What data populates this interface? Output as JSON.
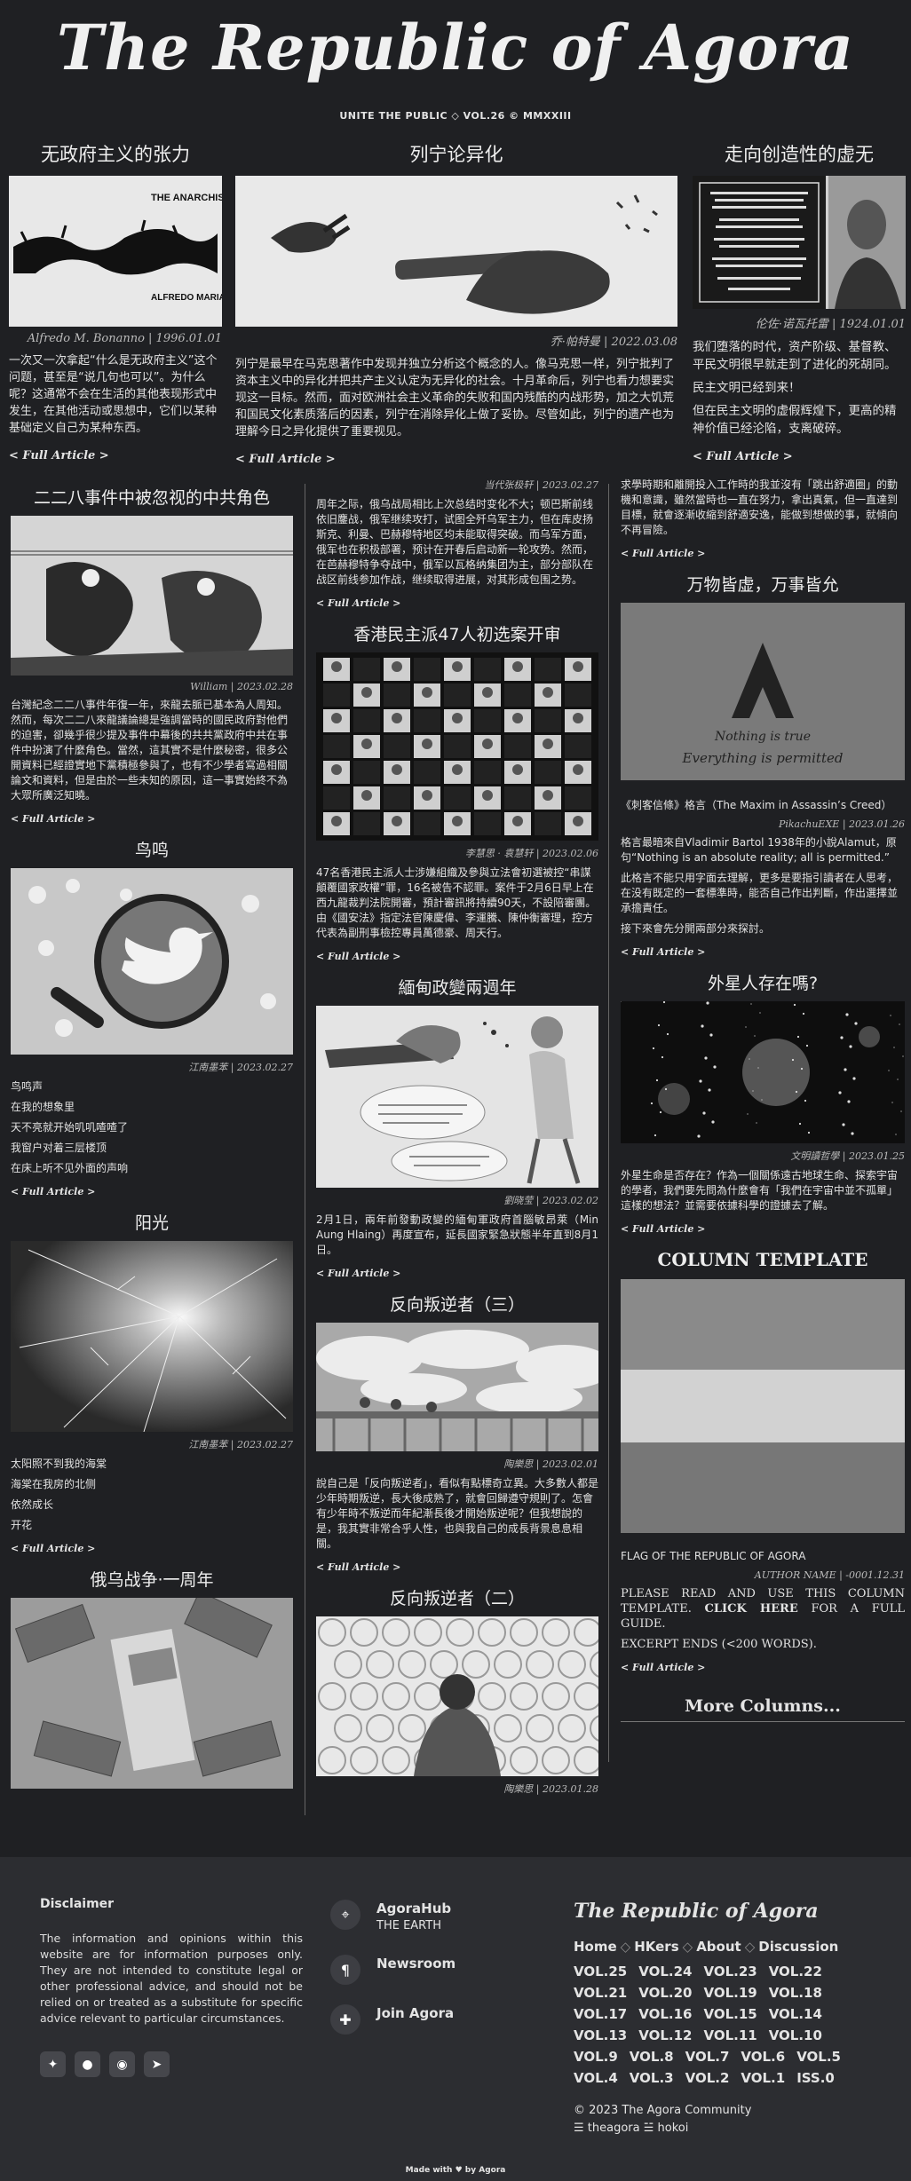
{
  "masthead": {
    "title": "The Republic of Agora",
    "tagline": "UNITE THE PUBLIC ◇ VOL.26 © MMXXIII"
  },
  "features": [
    {
      "title": "无政府主义的张力",
      "meta": "Alfredo M. Bonanno | 1996.01.01",
      "cover_text": [
        "THE ANARCHIST TENSION",
        "ALFREDO MARIA BONANNO"
      ],
      "body": [
        "一次又一次拿起“什么是无政府主义”这个问题，甚至是“说几句也可以”。为什么呢？这通常不会在生活的其他表现形式中发生，在其他活动或思想中，它们以某种基础定义自己为某种东西。"
      ],
      "more": "< Full Article >"
    },
    {
      "title": "列宁论异化",
      "meta": "乔·帕特曼 | 2022.03.08",
      "body": [
        "列宁是最早在马克思著作中发现并独立分析这个概念的人。像马克思一样，列宁批判了资本主义中的异化并把共产主义认定为无异化的社会。十月革命后，列宁也看力想要实现这一目标。然而，面对欧洲社会主义革命的失败和国内残酷的内战形势，加之大饥荒和国民文化素质落后的因素，列宁在消除异化上做了妥协。尽管如此，列宁的遗产也为理解今日之异化提供了重要视见。"
      ],
      "more": "< Full Article >"
    },
    {
      "title": "走向创造性的虚无",
      "meta": "伦佐·诺瓦托雷 | 1924.01.01",
      "body": [
        "我们堕落的时代，资产阶级、基督教、平民文明很早就走到了进化的死胡同。",
        "民主文明已经到来！",
        "但在民主文明的虚假辉煌下，更高的精神价值已经沦陷，支离破碎。"
      ],
      "more": "< Full Article >"
    }
  ],
  "col1": [
    {
      "title": "二二八事件中被忽视的中共角色",
      "meta": "William | 2023.02.28",
      "body": [
        "台灣紀念二二八事件年復一年，來龍去脈已基本為人周知。然而，每次二二八來龍議論總是強調當時的國民政府對他們的迫害，卻幾乎很少提及事件中幕後的共共黨政府中共在事件中扮演了什麼角色。當然，這其實不是什麼秘密，很多公開資料已經證實地下黨積極參與了，也有不少學者寫過相關論文和資料，但是由於一些未知的原因，這一事實始終不為大眾所廣泛知曉。"
      ],
      "more": "< Full Article >"
    },
    {
      "title": "鸟鸣",
      "meta": "江南墨苯 | 2023.02.27",
      "body": [
        "鸟鸣声",
        "在我的想象里",
        "天不亮就开始叽叽喳喳了",
        "我窗户对着三层楼顶",
        "在床上听不见外面的声响"
      ],
      "more": "< Full Article >"
    },
    {
      "title": "阳光",
      "meta": "江南墨苯 | 2023.02.27",
      "body": [
        "太阳照不到我的海棠",
        "海棠在我房的北侧",
        "依然成长",
        "开花"
      ],
      "more": "< Full Article >"
    },
    {
      "title": "俄乌战争·一周年"
    }
  ],
  "col2": [
    {
      "meta": "当代张极轩 | 2023.02.27",
      "body": [
        "周年之际，俄乌战局相比上次总结时变化不大；顿巴斯前线依旧鏖战，俄军继续攻打，试图全歼乌军主力，但在库皮扬斯克、利曼、巴赫穆特地区均未能取得突破。而乌军方面，俄军也在积极部署，预计在开春后启动新一轮攻势。然而，在芭赫穆特争夺战中，俄军以瓦格纳集团为主，部分部队在战区前线参加作战，继续取得进展，对其形成包围之势。"
      ],
      "more": "< Full Article >"
    },
    {
      "title": "香港民主派47人初选案开审",
      "meta": "李慧思 · 袁慧轩 | 2023.02.06",
      "body": [
        "47名香港民主派人士涉嫌組織及參與立法會初選被控“串謀顛覆國家政權”罪，16名被告不認罪。案件于2月6日早上在西九龍裁判法院開審，預計審訊將持續90天，不設陪審團。由《國安法》指定法官陳慶偉、李運騰、陳仲衡審理，控方代表為副刑事檢控專員萬德豪、周天行。"
      ],
      "more": "< Full Article >"
    },
    {
      "title": "緬甸政變兩週年",
      "meta": "劉晓莹 | 2023.02.02",
      "body": [
        "2月1日，兩年前發動政變的緬甸軍政府首腦敏昂萊（Min Aung Hlaing）再度宣布，延長國家緊急狀態半年直到8月1日。"
      ],
      "more": "< Full Article >"
    },
    {
      "title": "反向叛逆者（三）",
      "meta": "陶樂思 | 2023.02.01",
      "body": [
        "說自己是「反向叛逆者」，看似有點標奇立異。大多數人都是少年時期叛逆，長大後成熟了，就會回歸遵守規則了。怎會有少年時不叛逆而年紀漸長後才開始叛逆呢？但我想說的是，我其實非常合乎人性，也與我自己的成長背景息息相關。"
      ],
      "more": "< Full Article >"
    },
    {
      "title": "反向叛逆者（二）",
      "meta": "陶樂思 | 2023.01.28"
    }
  ],
  "col3": [
    {
      "body": [
        "求學時期和離開投入工作時的我並沒有「跳出舒適圈」的動機和意識，雖然當時也一直在努力，拿出真氣，但一直達到目標，就會逐漸收縮到舒適安逸，能做到想做的事，就傾向不再冒險。"
      ],
      "more": "< Full Article >"
    },
    {
      "title": "万物皆虚，万事皆允",
      "img_text": [
        "Nothing is true",
        "Everything is permitted"
      ],
      "caption": "《刺客信條》格言（The Maxim in Assassin’s Creed）",
      "meta": "PikachuEXE | 2023.01.26",
      "body": [
        "格言最暗來自Vladimir Bartol 1938年的小說Alamut，原句“Nothing is an absolute reality; all is permitted.”",
        "此格言不能只用字面去理解，更多是要指引讀者在人思考，在没有既定的一套標準時，能否自己作出判斷，作出選擇並承擔責任。",
        "接下來會先分開兩部分來探討。"
      ],
      "more": "< Full Article >"
    },
    {
      "title": "外星人存在嗎?",
      "meta": "文明讀哲學 | 2023.01.25",
      "body": [
        "外星生命是否存在？作為一個關係遠古地球生命、探索宇宙的學者，我們要先問為什麼會有「我們在宇宙中並不孤單」這樣的想法？並需要依據科學的證據去了解。"
      ],
      "more": "< Full Article >"
    },
    {
      "title": "COLUMN TEMPLATE",
      "caption": "FLAG OF THE REPUBLIC OF AGORA",
      "meta": "AUTHOR NAME | -0001.12.31",
      "body_pre": "PLEASE READ AND USE THIS COLUMN TEMPLATE.",
      "body_link": "CLICK HERE",
      "body_post": "FOR A FULL GUIDE.",
      "body2": "EXCERPT ENDS (<200 WORDS).",
      "more": "< Full Article >"
    }
  ],
  "more_columns": "More Columns...",
  "footer": {
    "disclaimer_title": "Disclaimer",
    "disclaimer_text": "The information and opinions within this website are for information purposes only. They are not intended to constitute legal or other professional advice, and should not be relied on or treated as a substitute for specific advice relevant to particular circumstances.",
    "links": [
      {
        "title": "AgoraHub",
        "sub": "THE EARTH",
        "icon": "location-pin-icon"
      },
      {
        "title": "Newsroom",
        "sub": "",
        "icon": "paragraph-icon"
      },
      {
        "title": "Join Agora",
        "sub": "",
        "icon": "puzzle-icon"
      }
    ],
    "brand": "The Republic of Agora",
    "nav": [
      "Home",
      "HKers",
      "About",
      "Discussion"
    ],
    "vols": [
      "VOL.25",
      "VOL.24",
      "VOL.23",
      "VOL.22",
      "VOL.21",
      "VOL.20",
      "VOL.19",
      "VOL.18",
      "VOL.17",
      "VOL.16",
      "VOL.15",
      "VOL.14",
      "VOL.13",
      "VOL.12",
      "VOL.11",
      "VOL.10",
      "VOL.9",
      "VOL.8",
      "VOL.7",
      "VOL.6",
      "VOL.5",
      "VOL.4",
      "VOL.3",
      "VOL.2",
      "VOL.1",
      "ISS.0"
    ],
    "copyright": "© 2023 The Agora Community",
    "credits": "☰ theagora ☱ hokoi",
    "made_with": "Made with ♥ by Agora"
  }
}
